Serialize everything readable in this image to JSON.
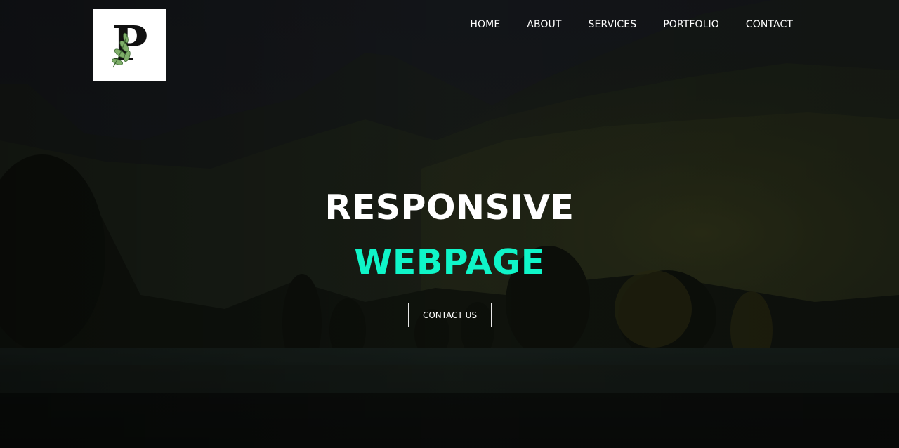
{
  "logo": {
    "letter": "P",
    "icon": "leaf-p-logo"
  },
  "nav": {
    "items": [
      {
        "label": "HOME"
      },
      {
        "label": "ABOUT"
      },
      {
        "label": "SERVICES"
      },
      {
        "label": "PORTFOLIO"
      },
      {
        "label": "CONTACT"
      }
    ]
  },
  "hero": {
    "line1": "RESPONSIVE",
    "line2": "WEBPAGE",
    "cta_label": "CONTACT US",
    "background": "dark-mountain-lake-landscape"
  },
  "colors": {
    "accent": "#0ff5c8",
    "text": "#ffffff",
    "overlay": "#111410"
  }
}
